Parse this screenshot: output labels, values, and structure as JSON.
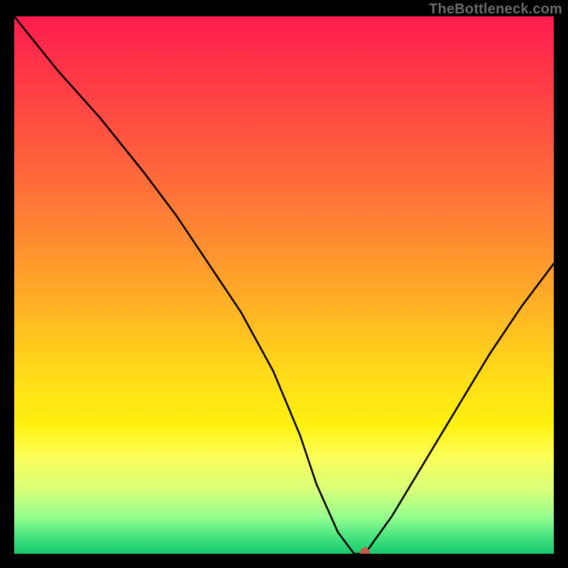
{
  "watermark": "TheBottleneck.com",
  "colors": {
    "frame_bg": "#000000",
    "curve_stroke": "#000000",
    "marker_fill": "#c85a4a",
    "gradient_stops": [
      "#ff1c4d",
      "#ff643c",
      "#ffb524",
      "#fff110",
      "#97ff8d",
      "#17c96e"
    ]
  },
  "chart_data": {
    "type": "line",
    "title": "",
    "xlabel": "",
    "ylabel": "",
    "xlim": [
      0,
      100
    ],
    "ylim": [
      0,
      100
    ],
    "series": [
      {
        "name": "bottleneck-curve",
        "x": [
          0,
          8,
          16,
          24,
          30,
          36,
          42,
          48,
          53,
          56,
          60,
          63,
          65,
          70,
          76,
          82,
          88,
          94,
          100
        ],
        "values": [
          100,
          90,
          81,
          71,
          63,
          54,
          45,
          34,
          22,
          13,
          4,
          0,
          0,
          7,
          17,
          27,
          37,
          46,
          54
        ]
      }
    ],
    "marker": {
      "x": 65,
      "y": 0,
      "name": "optimal-point"
    }
  }
}
